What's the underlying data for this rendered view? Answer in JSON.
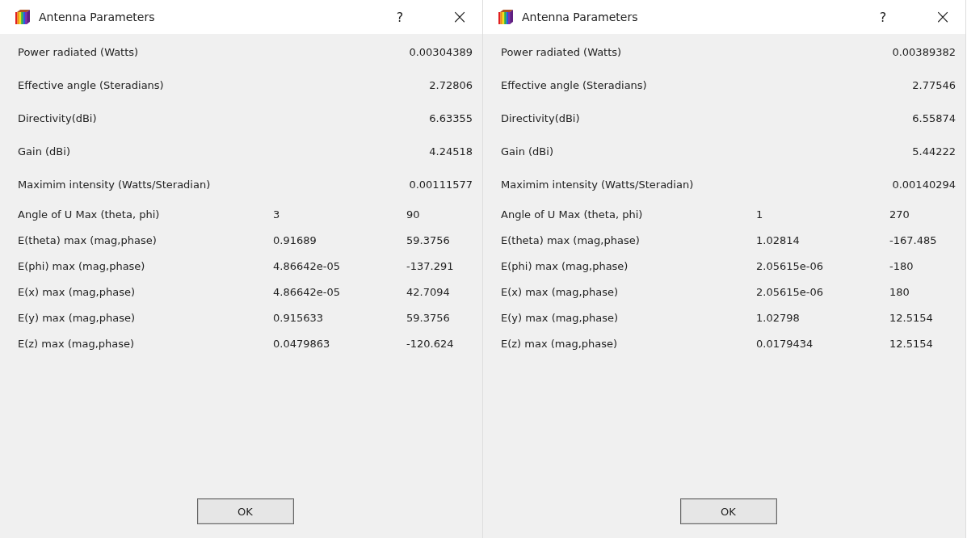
{
  "dialogs": [
    {
      "title": "Antenna Parameters",
      "help": "?",
      "close": "×",
      "ok": "OK",
      "rows": [
        {
          "kind": "single",
          "label": "Power radiated (Watts)",
          "value": "0.00304389"
        },
        {
          "kind": "single",
          "label": "Effective angle (Steradians)",
          "value": "2.72806"
        },
        {
          "kind": "single",
          "label": "Directivity(dBi)",
          "value": "6.63355"
        },
        {
          "kind": "single",
          "label": "Gain (dBi)",
          "value": "4.24518"
        },
        {
          "kind": "single",
          "label": "Maximim intensity (Watts/Steradian)",
          "value": "0.00111577"
        },
        {
          "kind": "pair",
          "label": "Angle of U Max (theta, phi)",
          "value": "3",
          "value_2": "90"
        },
        {
          "kind": "pair",
          "label": "E(theta) max (mag,phase)",
          "value": "0.91689",
          "value_2": "59.3756"
        },
        {
          "kind": "pair",
          "label": "E(phi) max (mag,phase)",
          "value": "4.86642e-05",
          "value_2": "-137.291"
        },
        {
          "kind": "pair",
          "label": "E(x) max (mag,phase)",
          "value": "4.86642e-05",
          "value_2": "42.7094"
        },
        {
          "kind": "pair",
          "label": "E(y) max (mag,phase)",
          "value": "0.915633",
          "value_2": "59.3756"
        },
        {
          "kind": "pair",
          "label": "E(z) max (mag,phase)",
          "value": "0.0479863",
          "value_2": "-120.624"
        }
      ]
    },
    {
      "title": "Antenna Parameters",
      "help": "?",
      "close": "×",
      "ok": "OK",
      "rows": [
        {
          "kind": "single",
          "label": "Power radiated (Watts)",
          "value": "0.00389382"
        },
        {
          "kind": "single",
          "label": "Effective angle (Steradians)",
          "value": "2.77546"
        },
        {
          "kind": "single",
          "label": "Directivity(dBi)",
          "value": "6.55874"
        },
        {
          "kind": "single",
          "label": "Gain (dBi)",
          "value": "5.44222"
        },
        {
          "kind": "single",
          "label": "Maximim intensity (Watts/Steradian)",
          "value": "0.00140294"
        },
        {
          "kind": "pair",
          "label": "Angle of U Max (theta, phi)",
          "value": "1",
          "value_2": "270"
        },
        {
          "kind": "pair",
          "label": "E(theta) max (mag,phase)",
          "value": "1.02814",
          "value_2": "-167.485"
        },
        {
          "kind": "pair",
          "label": "E(phi) max (mag,phase)",
          "value": "2.05615e-06",
          "value_2": "-180"
        },
        {
          "kind": "pair",
          "label": "E(x) max (mag,phase)",
          "value": "2.05615e-06",
          "value_2": "180"
        },
        {
          "kind": "pair",
          "label": "E(y) max (mag,phase)",
          "value": "1.02798",
          "value_2": "12.5154"
        },
        {
          "kind": "pair",
          "label": "E(z) max (mag,phase)",
          "value": "0.0179434",
          "value_2": "12.5154"
        }
      ]
    }
  ]
}
